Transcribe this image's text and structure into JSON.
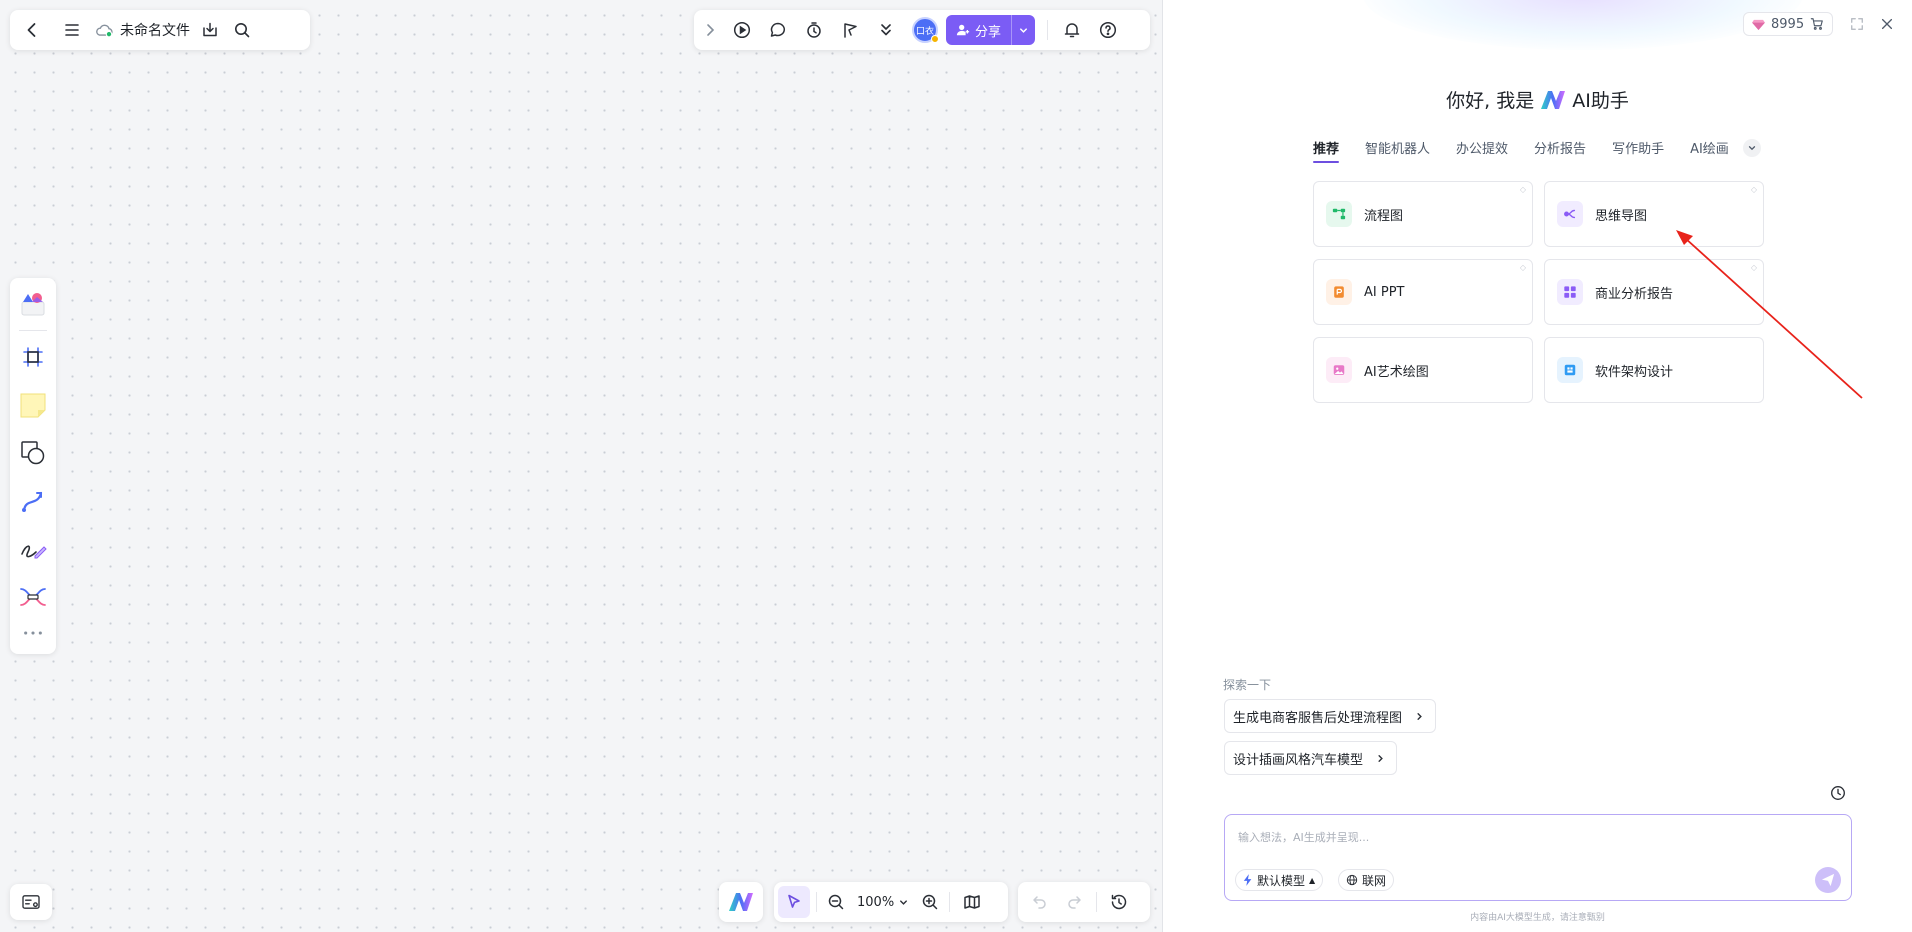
{
  "toolbar": {
    "filename": "未命名文件",
    "icons": [
      "back-icon",
      "menu-icon",
      "cloud-sync-icon",
      "download-icon",
      "search-icon"
    ]
  },
  "top_right": {
    "icons": [
      "expand-right-icon",
      "play-icon",
      "comment-icon",
      "timer-icon",
      "flag-icon",
      "collapse-icon",
      "bell-icon",
      "help-icon"
    ],
    "avatar_text": "口衣",
    "share_label": "分享"
  },
  "left_tools": [
    "templates-icon",
    "frame-icon",
    "sticky-note-icon",
    "shape-icon",
    "connector-icon",
    "pen-icon",
    "mindmap-icon",
    "more-icon"
  ],
  "bottom": {
    "zoom_label": "100%",
    "icons": [
      "minimap-icon",
      "ai-logo-icon",
      "pointer-icon",
      "zoom-out-icon",
      "zoom-in-icon",
      "map-icon",
      "undo-icon",
      "redo-icon",
      "history-icon"
    ]
  },
  "ai_panel": {
    "credits": "8995",
    "greeting_prefix": "你好, 我是",
    "greeting_suffix": "AI助手",
    "tabs": [
      "推荐",
      "智能机器人",
      "办公提效",
      "分析报告",
      "写作助手",
      "AI绘画"
    ],
    "active_tab": "推荐",
    "features": [
      {
        "label": "流程图",
        "icon": "flowchart-icon",
        "color": "#21b96a",
        "bg": "#e6f8ee"
      },
      {
        "label": "思维导图",
        "icon": "mindmap-icon",
        "color": "#8b5cf6",
        "bg": "#f1ecff"
      },
      {
        "label": "AI PPT",
        "icon": "ppt-icon",
        "color": "#f28b30",
        "bg": "#fff1e6"
      },
      {
        "label": "商业分析报告",
        "icon": "report-icon",
        "color": "#8b5cf6",
        "bg": "#f1ecff"
      },
      {
        "label": "AI艺术绘图",
        "icon": "art-icon",
        "color": "#e879c8",
        "bg": "#fdecf7"
      },
      {
        "label": "软件架构设计",
        "icon": "architecture-icon",
        "color": "#2f9bf3",
        "bg": "#e6f3fe"
      }
    ],
    "explore_label": "探索一下",
    "suggestions": [
      "生成电商客服售后处理流程图",
      "设计插画风格汽车模型"
    ],
    "input_placeholder": "输入想法，AI生成并呈现...",
    "model_label": "默认模型",
    "web_label": "联网",
    "disclaimer": "内容由AI大模型生成，请注意甄别"
  }
}
